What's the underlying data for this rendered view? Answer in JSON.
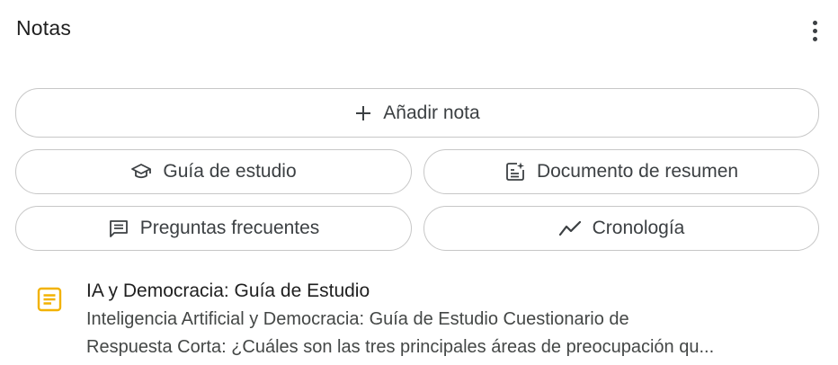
{
  "header": {
    "title": "Notas",
    "menu_icon": "more-vert-icon"
  },
  "actions": {
    "add_note": {
      "label": "Añadir nota",
      "icon": "plus-icon"
    },
    "study_guide": {
      "label": "Guía de estudio",
      "icon": "graduation-cap-icon"
    },
    "summary_doc": {
      "label": "Documento de resumen",
      "icon": "document-sparkle-icon"
    },
    "faq": {
      "label": "Preguntas frecuentes",
      "icon": "chat-list-icon"
    },
    "timeline": {
      "label": "Cronología",
      "icon": "trend-line-icon"
    }
  },
  "notes": [
    {
      "title": "IA y Democracia: Guía de Estudio",
      "line1": "Inteligencia Artificial y Democracia: Guía de Estudio Cuestionario de",
      "line2": "Respuesta Corta: ¿Cuáles son las tres principales áreas de preocupación qu...",
      "icon": "note-icon",
      "icon_color": "#f2b200"
    }
  ]
}
